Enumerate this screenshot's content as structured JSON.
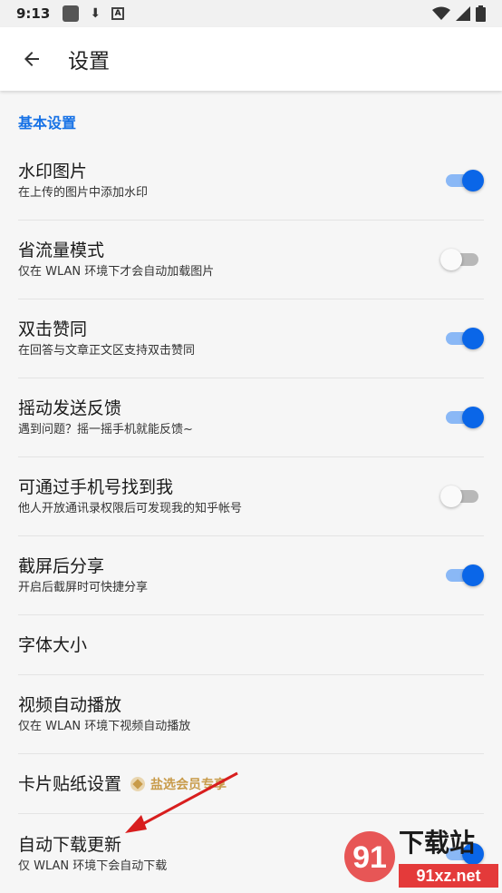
{
  "status_bar": {
    "time": "9:13"
  },
  "header": {
    "title": "设置"
  },
  "section": {
    "title": "基本设置"
  },
  "settings": [
    {
      "title": "水印图片",
      "subtitle": "在上传的图片中添加水印",
      "toggle": "on"
    },
    {
      "title": "省流量模式",
      "subtitle": "仅在 WLAN 环境下才会自动加载图片",
      "toggle": "off"
    },
    {
      "title": "双击赞同",
      "subtitle": "在回答与文章正文区支持双击赞同",
      "toggle": "on"
    },
    {
      "title": "摇动发送反馈",
      "subtitle": "遇到问题？摇一摇手机就能反馈~",
      "toggle": "on"
    },
    {
      "title": "可通过手机号找到我",
      "subtitle": "他人开放通讯录权限后可发现我的知乎帐号",
      "toggle": "off"
    },
    {
      "title": "截屏后分享",
      "subtitle": "开启后截屏时可快捷分享",
      "toggle": "on"
    },
    {
      "title": "字体大小"
    },
    {
      "title": "视频自动播放",
      "subtitle": "仅在 WLAN 环境下视频自动播放"
    },
    {
      "title": "卡片贴纸设置",
      "badge": "盐选会员专享"
    },
    {
      "title": "自动下载更新",
      "subtitle": "仅 WLAN 环境下会自动下载",
      "toggle": "on"
    }
  ],
  "watermark": {
    "brand": "下载站",
    "url": "91xz.net",
    "number": "91"
  },
  "colors": {
    "accent": "#0a66e8",
    "section": "#1772e6",
    "vip": "#c89b4a",
    "arrow": "#d81e1e"
  }
}
